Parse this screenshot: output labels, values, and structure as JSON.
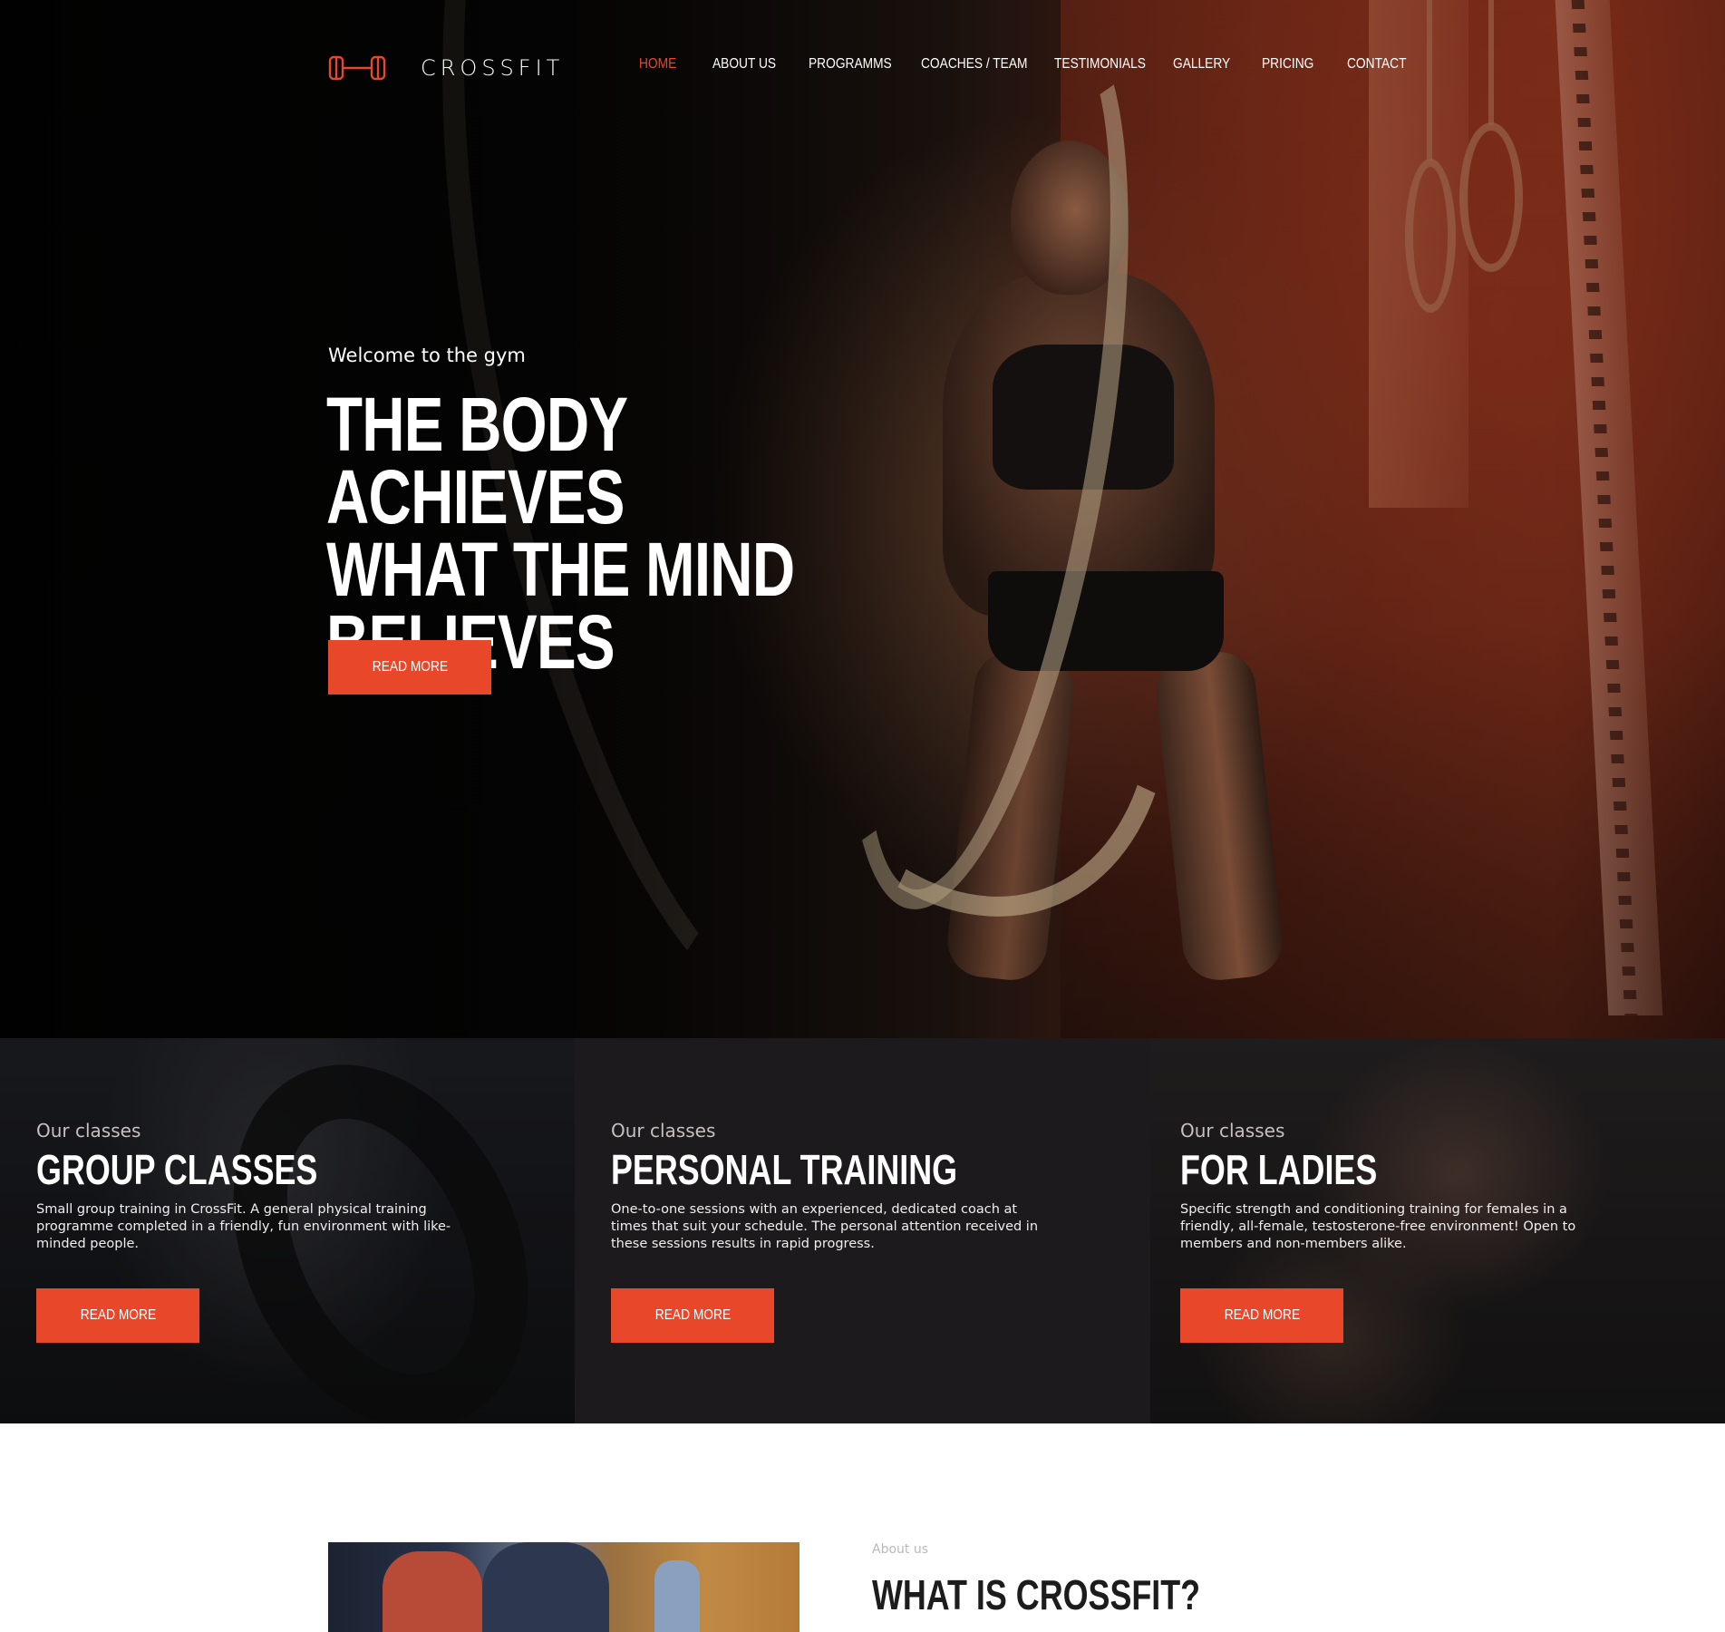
{
  "brand": {
    "name": "CROSSFIT",
    "accent": "#e8472a"
  },
  "nav": {
    "items": [
      {
        "label": "HOME",
        "active": true
      },
      {
        "label": "ABOUT US",
        "active": false
      },
      {
        "label": "PROGRAMMS",
        "active": false
      },
      {
        "label": "COACHES / TEAM",
        "active": false
      },
      {
        "label": "TESTIMONIALS",
        "active": false
      },
      {
        "label": "GALLERY",
        "active": false
      },
      {
        "label": "PRICING",
        "active": false
      },
      {
        "label": "CONTACT",
        "active": false
      }
    ]
  },
  "hero": {
    "welcome": "Welcome to the gym",
    "headline_lines": [
      "THE BODY ACHIEVES",
      "WHAT THE MIND",
      "BELIEVES"
    ],
    "button": "READ MORE"
  },
  "classes": [
    {
      "subtitle": "Our classes",
      "title": "GROUP CLASSES",
      "text": "Small group training in CrossFit. A general physical training programme completed in a friendly, fun environment with like-minded people.",
      "button": "READ MORE"
    },
    {
      "subtitle": "Our classes",
      "title": "PERSONAL TRAINING",
      "text": "One-to-one sessions with an experienced, dedicated coach at times that suit your schedule. The personal attention received in these sessions results in rapid progress.",
      "button": "READ MORE"
    },
    {
      "subtitle": "Our classes",
      "title": "FOR LADIES",
      "text": "Specific strength and conditioning training for females in a friendly, all-female, testosterone-free environment! Open to members and non-members alike.",
      "button": "READ MORE"
    }
  ],
  "about": {
    "subtitle": "About us",
    "title": "WHAT IS CROSSFIT?"
  },
  "icons": {
    "logo": "dumbbell-icon"
  }
}
